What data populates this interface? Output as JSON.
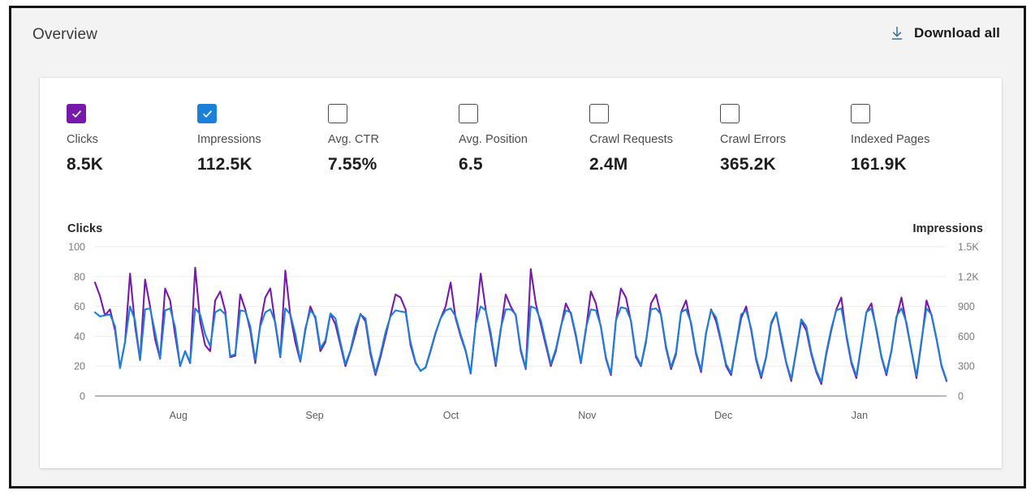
{
  "header": {
    "title": "Overview",
    "download_label": "Download all",
    "download_icon": "download-arrow-icon"
  },
  "metrics": [
    {
      "id": "clicks",
      "label": "Clicks",
      "value": "8.5K",
      "checked": true,
      "color": "#7719aa"
    },
    {
      "id": "impressions",
      "label": "Impressions",
      "value": "112.5K",
      "checked": true,
      "color": "#1a80d9"
    },
    {
      "id": "avg-ctr",
      "label": "Avg. CTR",
      "value": "7.55%",
      "checked": false,
      "color": "#ffffff"
    },
    {
      "id": "avg-position",
      "label": "Avg. Position",
      "value": "6.5",
      "checked": false,
      "color": "#ffffff"
    },
    {
      "id": "crawl-requests",
      "label": "Crawl Requests",
      "value": "2.4M",
      "checked": false,
      "color": "#ffffff"
    },
    {
      "id": "crawl-errors",
      "label": "Crawl Errors",
      "value": "365.2K",
      "checked": false,
      "color": "#ffffff"
    },
    {
      "id": "indexed-pages",
      "label": "Indexed Pages",
      "value": "161.9K",
      "checked": false,
      "color": "#ffffff"
    }
  ],
  "chart_data": {
    "type": "line",
    "title": "",
    "left_axis_label": "Clicks",
    "right_axis_label": "Impressions",
    "xlabel": "",
    "grid": true,
    "legend_position": "axis-titles",
    "left_ticks": [
      "0",
      "20",
      "40",
      "60",
      "80",
      "100"
    ],
    "left_tick_values": [
      0,
      20,
      40,
      60,
      80,
      100
    ],
    "ylim_left": [
      0,
      100
    ],
    "right_ticks": [
      "0",
      "300",
      "600",
      "900",
      "1.2K",
      "1.5K"
    ],
    "right_tick_values": [
      0,
      300,
      600,
      900,
      1200,
      1500
    ],
    "ylim_right": [
      0,
      1500
    ],
    "x_ticks": [
      "Aug",
      "Sep",
      "Oct",
      "Nov",
      "Dec",
      "Jan"
    ],
    "x_tick_positions": [
      0.098,
      0.258,
      0.418,
      0.578,
      0.738,
      0.898
    ],
    "series": [
      {
        "name": "Clicks",
        "color": "#7719aa",
        "axis": "left",
        "values": [
          76,
          67,
          54,
          58,
          44,
          19,
          36,
          82,
          47,
          24,
          78,
          60,
          38,
          25,
          72,
          64,
          41,
          20,
          30,
          22,
          86,
          50,
          34,
          30,
          64,
          70,
          57,
          26,
          27,
          68,
          58,
          44,
          22,
          48,
          66,
          72,
          48,
          26,
          84,
          54,
          36,
          23,
          44,
          60,
          52,
          30,
          36,
          55,
          48,
          34,
          20,
          30,
          42,
          55,
          50,
          28,
          14,
          26,
          40,
          54,
          68,
          66,
          58,
          34,
          22,
          17,
          19,
          30,
          42,
          52,
          60,
          76,
          52,
          40,
          30,
          15,
          48,
          82,
          58,
          40,
          20,
          44,
          68,
          60,
          54,
          30,
          18,
          85,
          62,
          48,
          34,
          20,
          30,
          46,
          62,
          55,
          40,
          22,
          44,
          70,
          62,
          46,
          25,
          14,
          50,
          72,
          66,
          50,
          26,
          20,
          36,
          62,
          68,
          54,
          32,
          18,
          28,
          56,
          64,
          48,
          28,
          16,
          42,
          58,
          50,
          36,
          20,
          14,
          34,
          52,
          60,
          44,
          24,
          12,
          26,
          48,
          56,
          38,
          22,
          10,
          30,
          50,
          44,
          28,
          16,
          8,
          28,
          44,
          58,
          66,
          40,
          22,
          12,
          34,
          56,
          62,
          44,
          26,
          14,
          30,
          52,
          66,
          48,
          30,
          12,
          36,
          64,
          54,
          38,
          20,
          10
        ]
      },
      {
        "name": "Impressions",
        "color": "#1a80d9",
        "axis": "right",
        "values": [
          840,
          800,
          810,
          820,
          700,
          280,
          540,
          900,
          760,
          360,
          870,
          880,
          640,
          380,
          860,
          880,
          690,
          300,
          450,
          340,
          880,
          820,
          620,
          500,
          840,
          870,
          820,
          400,
          420,
          860,
          850,
          700,
          360,
          700,
          840,
          870,
          740,
          400,
          880,
          820,
          620,
          350,
          680,
          860,
          800,
          480,
          560,
          830,
          780,
          540,
          320,
          460,
          680,
          820,
          780,
          450,
          230,
          420,
          640,
          800,
          860,
          850,
          840,
          540,
          340,
          250,
          290,
          460,
          640,
          780,
          860,
          880,
          800,
          620,
          460,
          230,
          720,
          900,
          860,
          640,
          320,
          680,
          870,
          870,
          820,
          470,
          280,
          900,
          880,
          760,
          540,
          320,
          470,
          700,
          860,
          840,
          620,
          340,
          680,
          870,
          860,
          700,
          390,
          220,
          760,
          890,
          880,
          760,
          410,
          310,
          560,
          870,
          880,
          820,
          500,
          290,
          440,
          840,
          870,
          740,
          440,
          260,
          640,
          860,
          790,
          560,
          320,
          230,
          520,
          820,
          860,
          680,
          380,
          200,
          400,
          740,
          840,
          600,
          340,
          170,
          460,
          770,
          700,
          440,
          260,
          140,
          440,
          680,
          860,
          880,
          620,
          350,
          200,
          520,
          840,
          880,
          680,
          400,
          230,
          460,
          800,
          880,
          740,
          460,
          200,
          560,
          880,
          820,
          580,
          310,
          160
        ]
      }
    ]
  }
}
